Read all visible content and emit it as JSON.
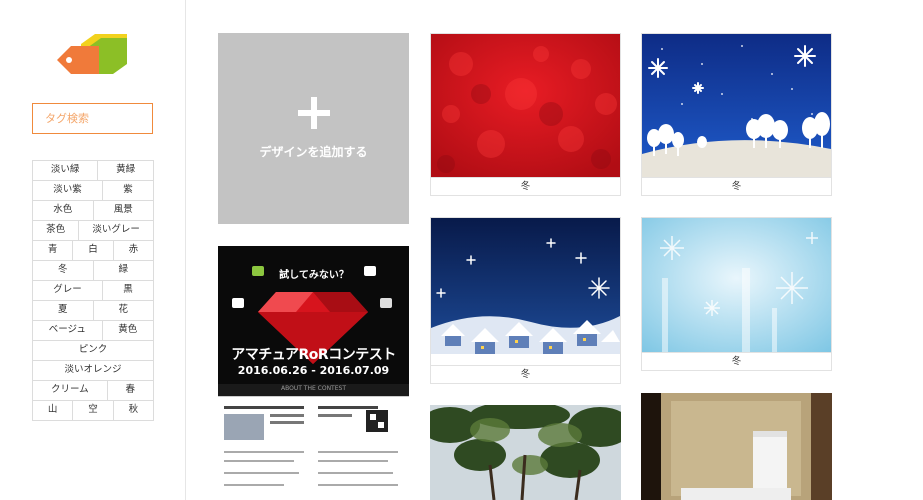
{
  "search": {
    "placeholder": "タグ検索"
  },
  "tags": [
    [
      "淡い緑",
      "黄緑"
    ],
    [
      "淡い紫",
      "紫"
    ],
    [
      "水色",
      "風景"
    ],
    [
      "茶色",
      "淡いグレー"
    ],
    [
      "青",
      "白",
      "赤"
    ],
    [
      "冬",
      "緑"
    ],
    [
      "グレー",
      "黒"
    ],
    [
      "夏",
      "花"
    ],
    [
      "ベージュ",
      "黄色"
    ],
    [
      "ピンク"
    ],
    [
      "淡いオレンジ"
    ],
    [
      "クリーム",
      "春"
    ],
    [
      "山",
      "空",
      "秋"
    ]
  ],
  "add_design": {
    "label": "デザインを追加する"
  },
  "cards": {
    "red_hearts": {
      "caption": "冬"
    },
    "snow_trees": {
      "caption": "冬"
    },
    "snow_village": {
      "caption": "冬"
    },
    "ice_blue": {
      "caption": "冬"
    }
  },
  "poster": {
    "headline": "試してみない？",
    "brand": "RoR",
    "title": "アマチュアRoRコンテスト",
    "dates": "2016.06.26 - 2016.07.09",
    "sub": "ABOUT THE CONTEST"
  },
  "colors": {
    "accent": "#f08a3c",
    "logo_orange": "#f07a3a",
    "logo_green": "#8cbf26",
    "logo_yellow": "#f2d21d"
  }
}
